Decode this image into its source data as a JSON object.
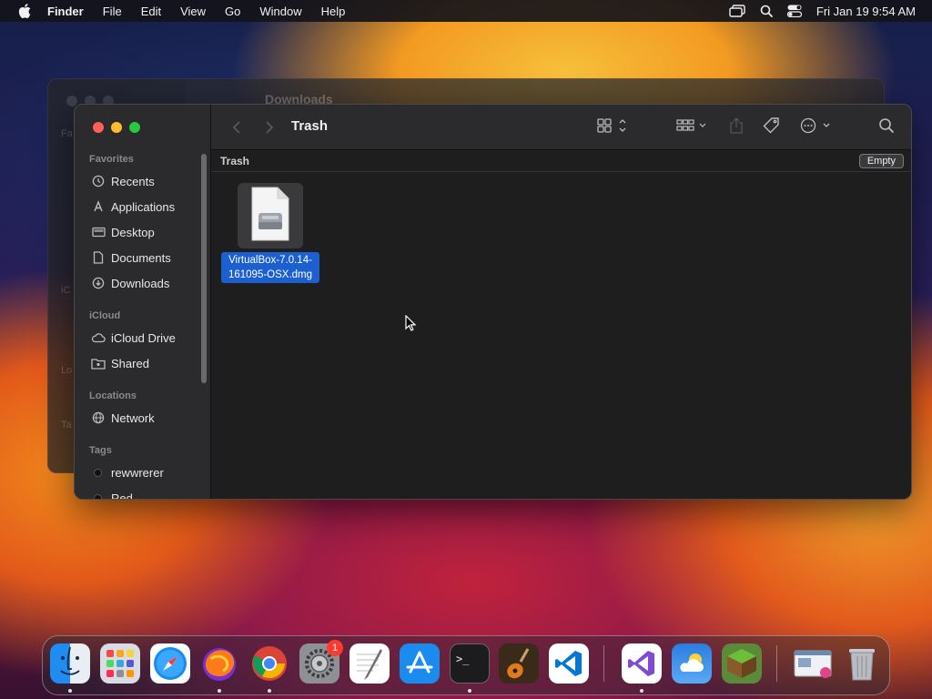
{
  "menubar": {
    "app_name": "Finder",
    "items": [
      "File",
      "Edit",
      "View",
      "Go",
      "Window",
      "Help"
    ],
    "clock": "Fri Jan 19  9:54 AM"
  },
  "background_window": {
    "title": "Downloads",
    "sidebar_labels": [
      "Fa",
      "iC",
      "Lo",
      "Ta"
    ]
  },
  "window": {
    "title": "Trash",
    "path_label": "Trash",
    "empty_button": "Empty",
    "sidebar": {
      "favorites_label": "Favorites",
      "favorites": [
        {
          "label": "Recents",
          "icon": "clock-icon"
        },
        {
          "label": "Applications",
          "icon": "applications-icon"
        },
        {
          "label": "Desktop",
          "icon": "desktop-icon"
        },
        {
          "label": "Documents",
          "icon": "document-icon"
        },
        {
          "label": "Downloads",
          "icon": "download-icon"
        }
      ],
      "icloud_label": "iCloud",
      "icloud": [
        {
          "label": "iCloud Drive",
          "icon": "cloud-icon"
        },
        {
          "label": "Shared",
          "icon": "shared-folder-icon"
        }
      ],
      "locations_label": "Locations",
      "locations": [
        {
          "label": "Network",
          "icon": "globe-icon"
        }
      ],
      "tags_label": "Tags",
      "tags": [
        {
          "label": "rewwrerer",
          "color": "#111111"
        },
        {
          "label": "Red",
          "color": "#111111"
        }
      ]
    },
    "files": [
      {
        "name_line1": "VirtualBox-7.0.14-",
        "name_line2": "161095-OSX.dmg",
        "icon": "disk-image-icon",
        "selected": true
      }
    ]
  },
  "dock": {
    "apps": [
      {
        "name": "Finder",
        "icon": "finder-icon"
      },
      {
        "name": "Launchpad",
        "icon": "launchpad-icon"
      },
      {
        "name": "Safari",
        "icon": "safari-icon"
      },
      {
        "name": "Firefox",
        "icon": "firefox-icon"
      },
      {
        "name": "Chrome",
        "icon": "chrome-icon"
      },
      {
        "name": "System Settings",
        "icon": "settings-icon",
        "badge": "1"
      },
      {
        "name": "TextEdit",
        "icon": "textedit-icon"
      },
      {
        "name": "App Store",
        "icon": "appstore-icon"
      },
      {
        "name": "Terminal",
        "icon": "terminal-icon"
      },
      {
        "name": "GarageBand",
        "icon": "guitar-icon"
      },
      {
        "name": "Visual Studio Code",
        "icon": "vscode-icon"
      },
      {
        "name": "Visual Studio",
        "icon": "visualstudio-icon"
      },
      {
        "name": "Weather",
        "icon": "weather-icon"
      },
      {
        "name": "Minecraft",
        "icon": "minecraft-icon"
      },
      {
        "name": "Preview",
        "icon": "preview-icon"
      },
      {
        "name": "Trash",
        "icon": "trash-icon"
      }
    ]
  }
}
